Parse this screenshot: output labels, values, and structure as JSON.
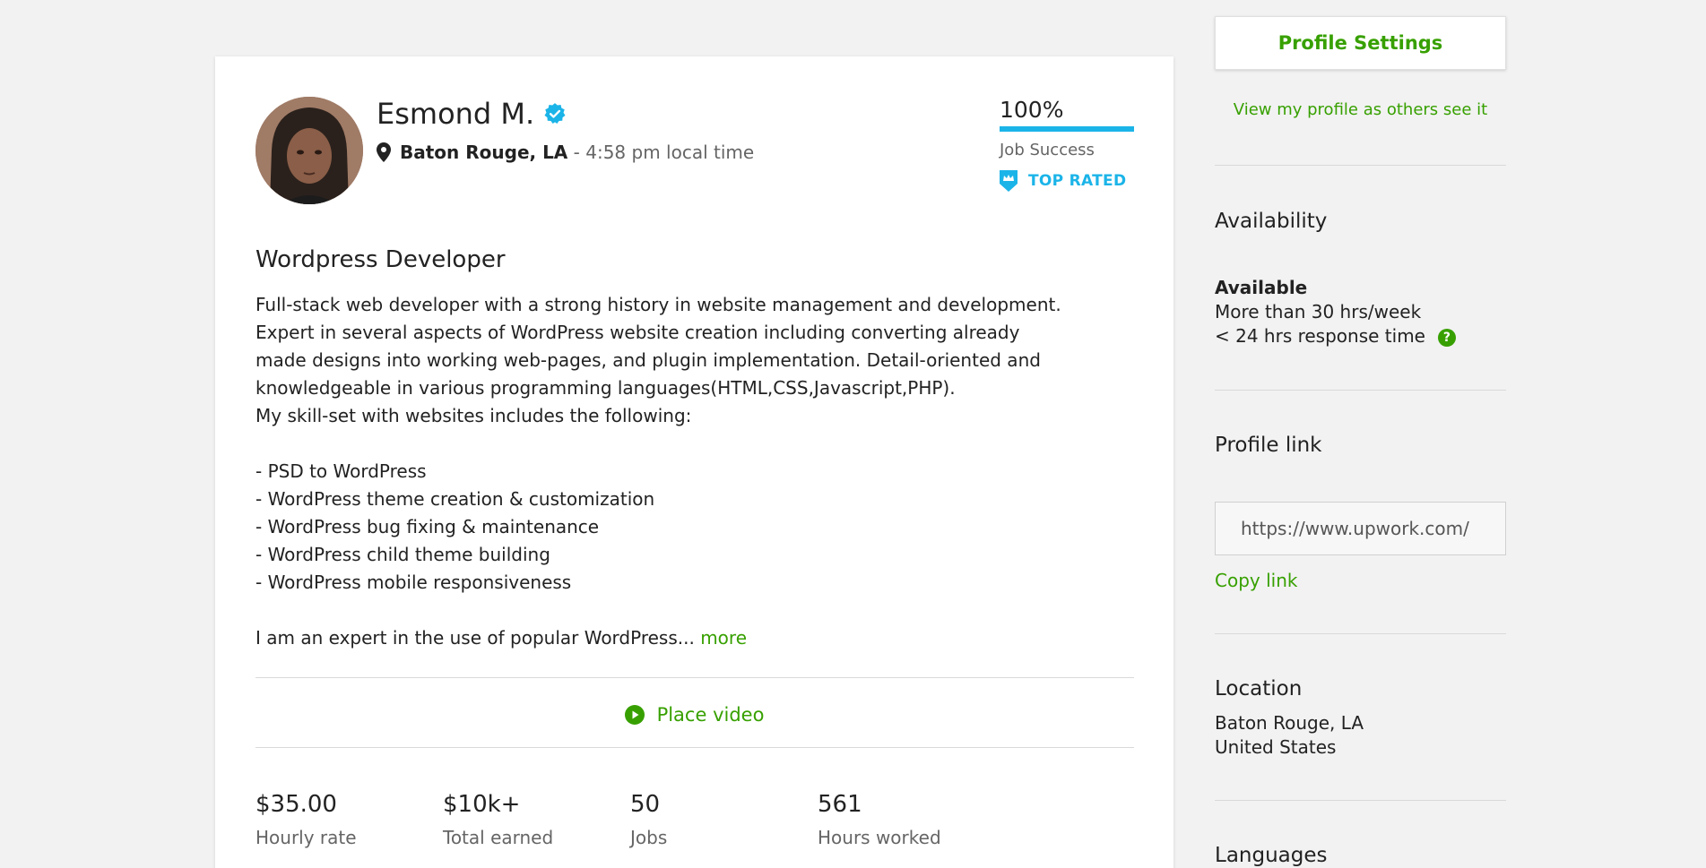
{
  "profile": {
    "name": "Esmond M.",
    "location": "Baton Rouge, LA",
    "local_time": " - 4:58 pm local time",
    "job_success_value": "100%",
    "job_success_fraction": 1.0,
    "job_success_label": "Job Success",
    "top_rated": "TOP RATED",
    "title": "Wordpress Developer",
    "description": [
      "Full-stack web developer with a strong history in website management and development.",
      "Expert in several aspects of WordPress website creation including converting already",
      "made designs into working web-pages, and plugin implementation. Detail-oriented and",
      "knowledgeable in various programming languages(HTML,CSS,Javascript,PHP).",
      "My skill-set with websites includes the following:",
      "",
      "- PSD to WordPress",
      "- WordPress theme creation & customization",
      "- WordPress bug fixing & maintenance",
      "- WordPress child theme building",
      "- WordPress mobile responsiveness",
      "",
      "I am an expert in the use of popular WordPress..."
    ],
    "more_label": "more",
    "video_label": "Place video",
    "stats": [
      {
        "value": "$35.00",
        "label": "Hourly rate"
      },
      {
        "value": "$10k+",
        "label": "Total earned"
      },
      {
        "value": "50",
        "label": "Jobs"
      },
      {
        "value": "561",
        "label": "Hours worked"
      }
    ]
  },
  "sidebar": {
    "settings_button": "Profile Settings",
    "view_as_others": "View my profile as others see it",
    "availability": {
      "heading": "Availability",
      "status": "Available",
      "hours": "More than 30 hrs/week",
      "response": "< 24 hrs response time",
      "help_icon": "?"
    },
    "profile_link": {
      "heading": "Profile link",
      "value": "https://www.upwork.com/",
      "copy_label": "Copy link"
    },
    "location": {
      "heading": "Location",
      "city": "Baton Rouge, LA",
      "country": "United States"
    },
    "languages": {
      "heading": "Languages"
    }
  },
  "colors": {
    "accent": "#37a000",
    "info": "#1bb4e8"
  }
}
